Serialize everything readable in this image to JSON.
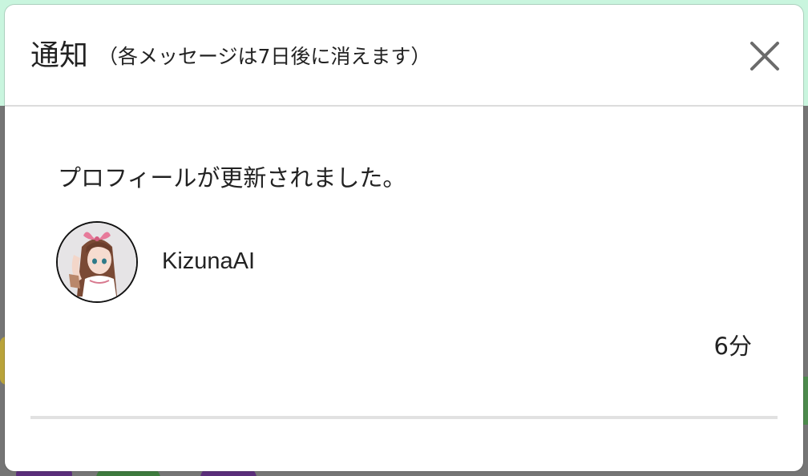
{
  "modal": {
    "title": "通知",
    "subtitle": "（各メッセージは7日後に消えます）",
    "close_icon": "close-icon"
  },
  "notification": {
    "message": "プロフィールが更新されました。",
    "username": "KizunaAI",
    "time": "6分",
    "avatar_icon": "user-avatar"
  },
  "colors": {
    "background_band": "#c9f5de",
    "text": "#222222",
    "divider": "#e1e1e1"
  }
}
